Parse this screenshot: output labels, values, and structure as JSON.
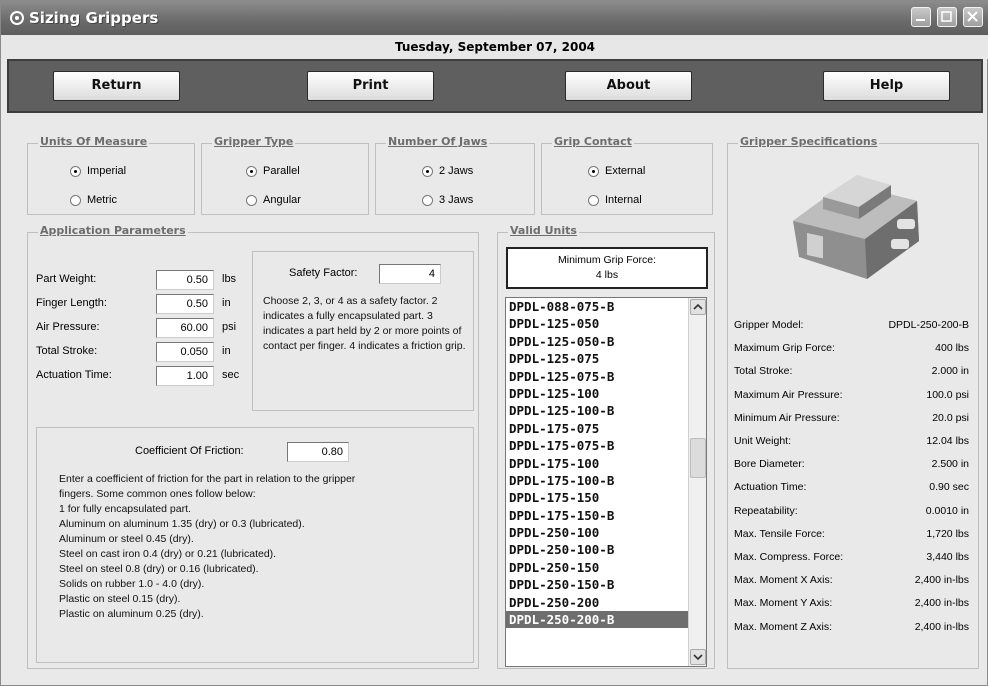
{
  "window": {
    "title": "Sizing Grippers",
    "date": "Tuesday, September 07, 2004"
  },
  "toolbar": {
    "return_label": "Return",
    "print_label": "Print",
    "about_label": "About",
    "help_label": "Help"
  },
  "units": {
    "title": "Units Of Measure",
    "options": [
      "Imperial",
      "Metric"
    ],
    "selected": "Imperial"
  },
  "gripper_type": {
    "title": "Gripper Type",
    "options": [
      "Parallel",
      "Angular"
    ],
    "selected": "Parallel"
  },
  "jaws": {
    "title": "Number Of Jaws",
    "options": [
      "2 Jaws",
      "3 Jaws"
    ],
    "selected": "2 Jaws"
  },
  "grip_contact": {
    "title": "Grip Contact",
    "options": [
      "External",
      "Internal"
    ],
    "selected": "External"
  },
  "app_params": {
    "title": "Application Parameters",
    "rows": [
      {
        "label": "Part Weight:",
        "value": "0.50",
        "unit": "lbs"
      },
      {
        "label": "Finger Length:",
        "value": "0.50",
        "unit": "in"
      },
      {
        "label": "Air Pressure:",
        "value": "60.00",
        "unit": "psi"
      },
      {
        "label": "Total Stroke:",
        "value": "0.050",
        "unit": "in"
      },
      {
        "label": "Actuation Time:",
        "value": "1.00",
        "unit": "sec"
      }
    ]
  },
  "safety": {
    "label": "Safety Factor:",
    "value": "4",
    "description": "Choose 2, 3, or 4 as a safety factor. 2 indicates a fully encapsulated part. 3 indicates a part held by 2 or more points of contact per finger. 4 indicates a friction grip."
  },
  "friction": {
    "label": "Coefficient Of Friction:",
    "value": "0.80",
    "lines": [
      "Enter a coefficient of friction for the part in relation to the gripper",
      "fingers. Some common ones follow below:",
      "1 for fully encapsulated part.",
      "Aluminum on aluminum 1.35 (dry) or 0.3 (lubricated).",
      "Aluminum or steel 0.45 (dry).",
      "Steel on cast iron 0.4 (dry) or 0.21 (lubricated).",
      "Steel on steel 0.8 (dry) or 0.16 (lubricated).",
      "Solids on rubber 1.0 - 4.0 (dry).",
      "Plastic on steel 0.15 (dry).",
      "Plastic on aluminum 0.25 (dry)."
    ]
  },
  "valid_units": {
    "title": "Valid Units",
    "min_grip_label": "Minimum Grip Force:",
    "min_grip_value": "4  lbs",
    "items": [
      "DPDL-088-075-B",
      "DPDL-125-050",
      "DPDL-125-050-B",
      "DPDL-125-075",
      "DPDL-125-075-B",
      "DPDL-125-100",
      "DPDL-125-100-B",
      "DPDL-175-075",
      "DPDL-175-075-B",
      "DPDL-175-100",
      "DPDL-175-100-B",
      "DPDL-175-150",
      "DPDL-175-150-B",
      "DPDL-250-100",
      "DPDL-250-100-B",
      "DPDL-250-150",
      "DPDL-250-150-B",
      "DPDL-250-200",
      "DPDL-250-200-B"
    ],
    "selected": "DPDL-250-200-B"
  },
  "specs": {
    "title": "Gripper Specifications",
    "rows": [
      {
        "label": "Gripper Model:",
        "value": "DPDL-250-200-B"
      },
      {
        "label": "Maximum Grip Force:",
        "value": "400  lbs"
      },
      {
        "label": "Total Stroke:",
        "value": "2.000  in"
      },
      {
        "label": "Maximum Air Pressure:",
        "value": "100.0  psi"
      },
      {
        "label": "Minimum Air Pressure:",
        "value": "20.0  psi"
      },
      {
        "label": "Unit Weight:",
        "value": "12.04  lbs"
      },
      {
        "label": "Bore Diameter:",
        "value": "2.500  in"
      },
      {
        "label": "Actuation Time:",
        "value": "0.90  sec"
      },
      {
        "label": "Repeatability:",
        "value": "0.0010  in"
      },
      {
        "label": "Max. Tensile Force:",
        "value": "1,720  lbs"
      },
      {
        "label": "Max. Compress. Force:",
        "value": "3,440  lbs"
      },
      {
        "label": "Max. Moment X Axis:",
        "value": "2,400  in-lbs"
      },
      {
        "label": "Max. Moment Y Axis:",
        "value": "2,400  in-lbs"
      },
      {
        "label": "Max. Moment Z Axis:",
        "value": "2,400  in-lbs"
      }
    ]
  }
}
